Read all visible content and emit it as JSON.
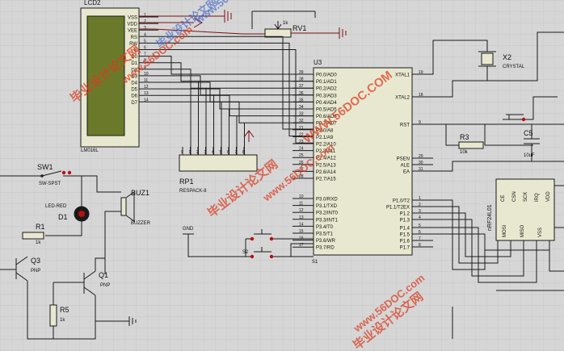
{
  "lcd": {
    "ref": "LCD2",
    "part": "LM016L",
    "pins": [
      "VSS",
      "VDD",
      "VEE",
      "RS",
      "RW",
      "E",
      "D0",
      "D1",
      "D2",
      "D3",
      "D4",
      "D5",
      "D6",
      "D7"
    ],
    "pin_numbers": [
      "1",
      "2",
      "3",
      "4",
      "5",
      "6",
      "7",
      "8",
      "9",
      "10",
      "11",
      "12",
      "13",
      "14"
    ]
  },
  "rv1": {
    "ref": "RV1",
    "value": "1k"
  },
  "u3": {
    "ref": "U3",
    "left_pins": [
      "P0.0/AD0",
      "P0.1/AD1",
      "P0.2/AD2",
      "P0.3/AD3",
      "P0.4/AD4",
      "P0.5/AD5",
      "P0.6/AD6",
      "P0.7/AD7",
      "P2.0/A8",
      "P2.1/A9",
      "P2.2/A10",
      "P2.3/A11",
      "P2.4/A12",
      "P2.5/A13",
      "P2.6/A14",
      "P2.7/A15",
      "P3.0/RXD",
      "P3.1/TXD",
      "P3.2/INT0",
      "P3.3/INT1",
      "P3.4/T0",
      "P3.5/T1",
      "P3.6/WR",
      "P3.7/RD"
    ],
    "left_nums": [
      "39",
      "38",
      "37",
      "36",
      "35",
      "34",
      "33",
      "32",
      "21",
      "22",
      "23",
      "24",
      "25",
      "26",
      "27",
      "28",
      "10",
      "11",
      "12",
      "13",
      "14",
      "15",
      "16",
      "17"
    ],
    "right_pins": [
      "XTAL1",
      "XTAL2",
      "RST",
      "PSEN",
      "ALE",
      "EA",
      "P1.0/T2",
      "P1.1/T2EX",
      "P1.2",
      "P1.3",
      "P1.4",
      "P1.5",
      "P1.6",
      "P1.7"
    ],
    "right_nums": [
      "19",
      "18",
      "9",
      "29",
      "30",
      "31",
      "1",
      "2",
      "3",
      "4",
      "5",
      "6",
      "7",
      "8"
    ]
  },
  "x2": {
    "ref": "X2",
    "part": "CRYSTAL"
  },
  "r3": {
    "ref": "R3",
    "value": "10k"
  },
  "c5": {
    "ref": "C5",
    "value": "10uF"
  },
  "rp1": {
    "ref": "RP1",
    "part": "RESPACK-8",
    "pin_numbers": [
      "9",
      "1",
      "2",
      "3",
      "4",
      "5",
      "6",
      "7",
      "8"
    ]
  },
  "nrf": {
    "ref": "nRF24L01",
    "pins_top": [
      "CE",
      "CSN",
      "SCK",
      "IRQ",
      "VDD"
    ],
    "pins_bottom": [
      "MOSI",
      "MISO",
      "VSS"
    ]
  },
  "sw1": {
    "ref": "SW1",
    "part": "SW-SPST"
  },
  "d1": {
    "ref": "D1",
    "part": "LED-RED"
  },
  "buz1": {
    "ref": "BUZ1",
    "part": "BUZZER"
  },
  "r1": {
    "ref": "R1",
    "value": "1k"
  },
  "q3": {
    "ref": "Q3",
    "part": "PNP"
  },
  "q1": {
    "ref": "Q1",
    "part": "PNP"
  },
  "r5": {
    "ref": "R5",
    "value": "1k"
  },
  "gnd": {
    "label": "GND"
  },
  "s1": {
    "ref": "S1"
  },
  "s2": {
    "ref": "S2"
  },
  "watermarks": [
    "毕业设计论文网",
    "www.56DOC.com",
    "WWW.56DOC.COM",
    "毕业设计论文网",
    "www.56DOC.com",
    "www.56DOC.com",
    "毕业设计论文网",
    "www.56DOC.com",
    "毕业设计论文网"
  ]
}
